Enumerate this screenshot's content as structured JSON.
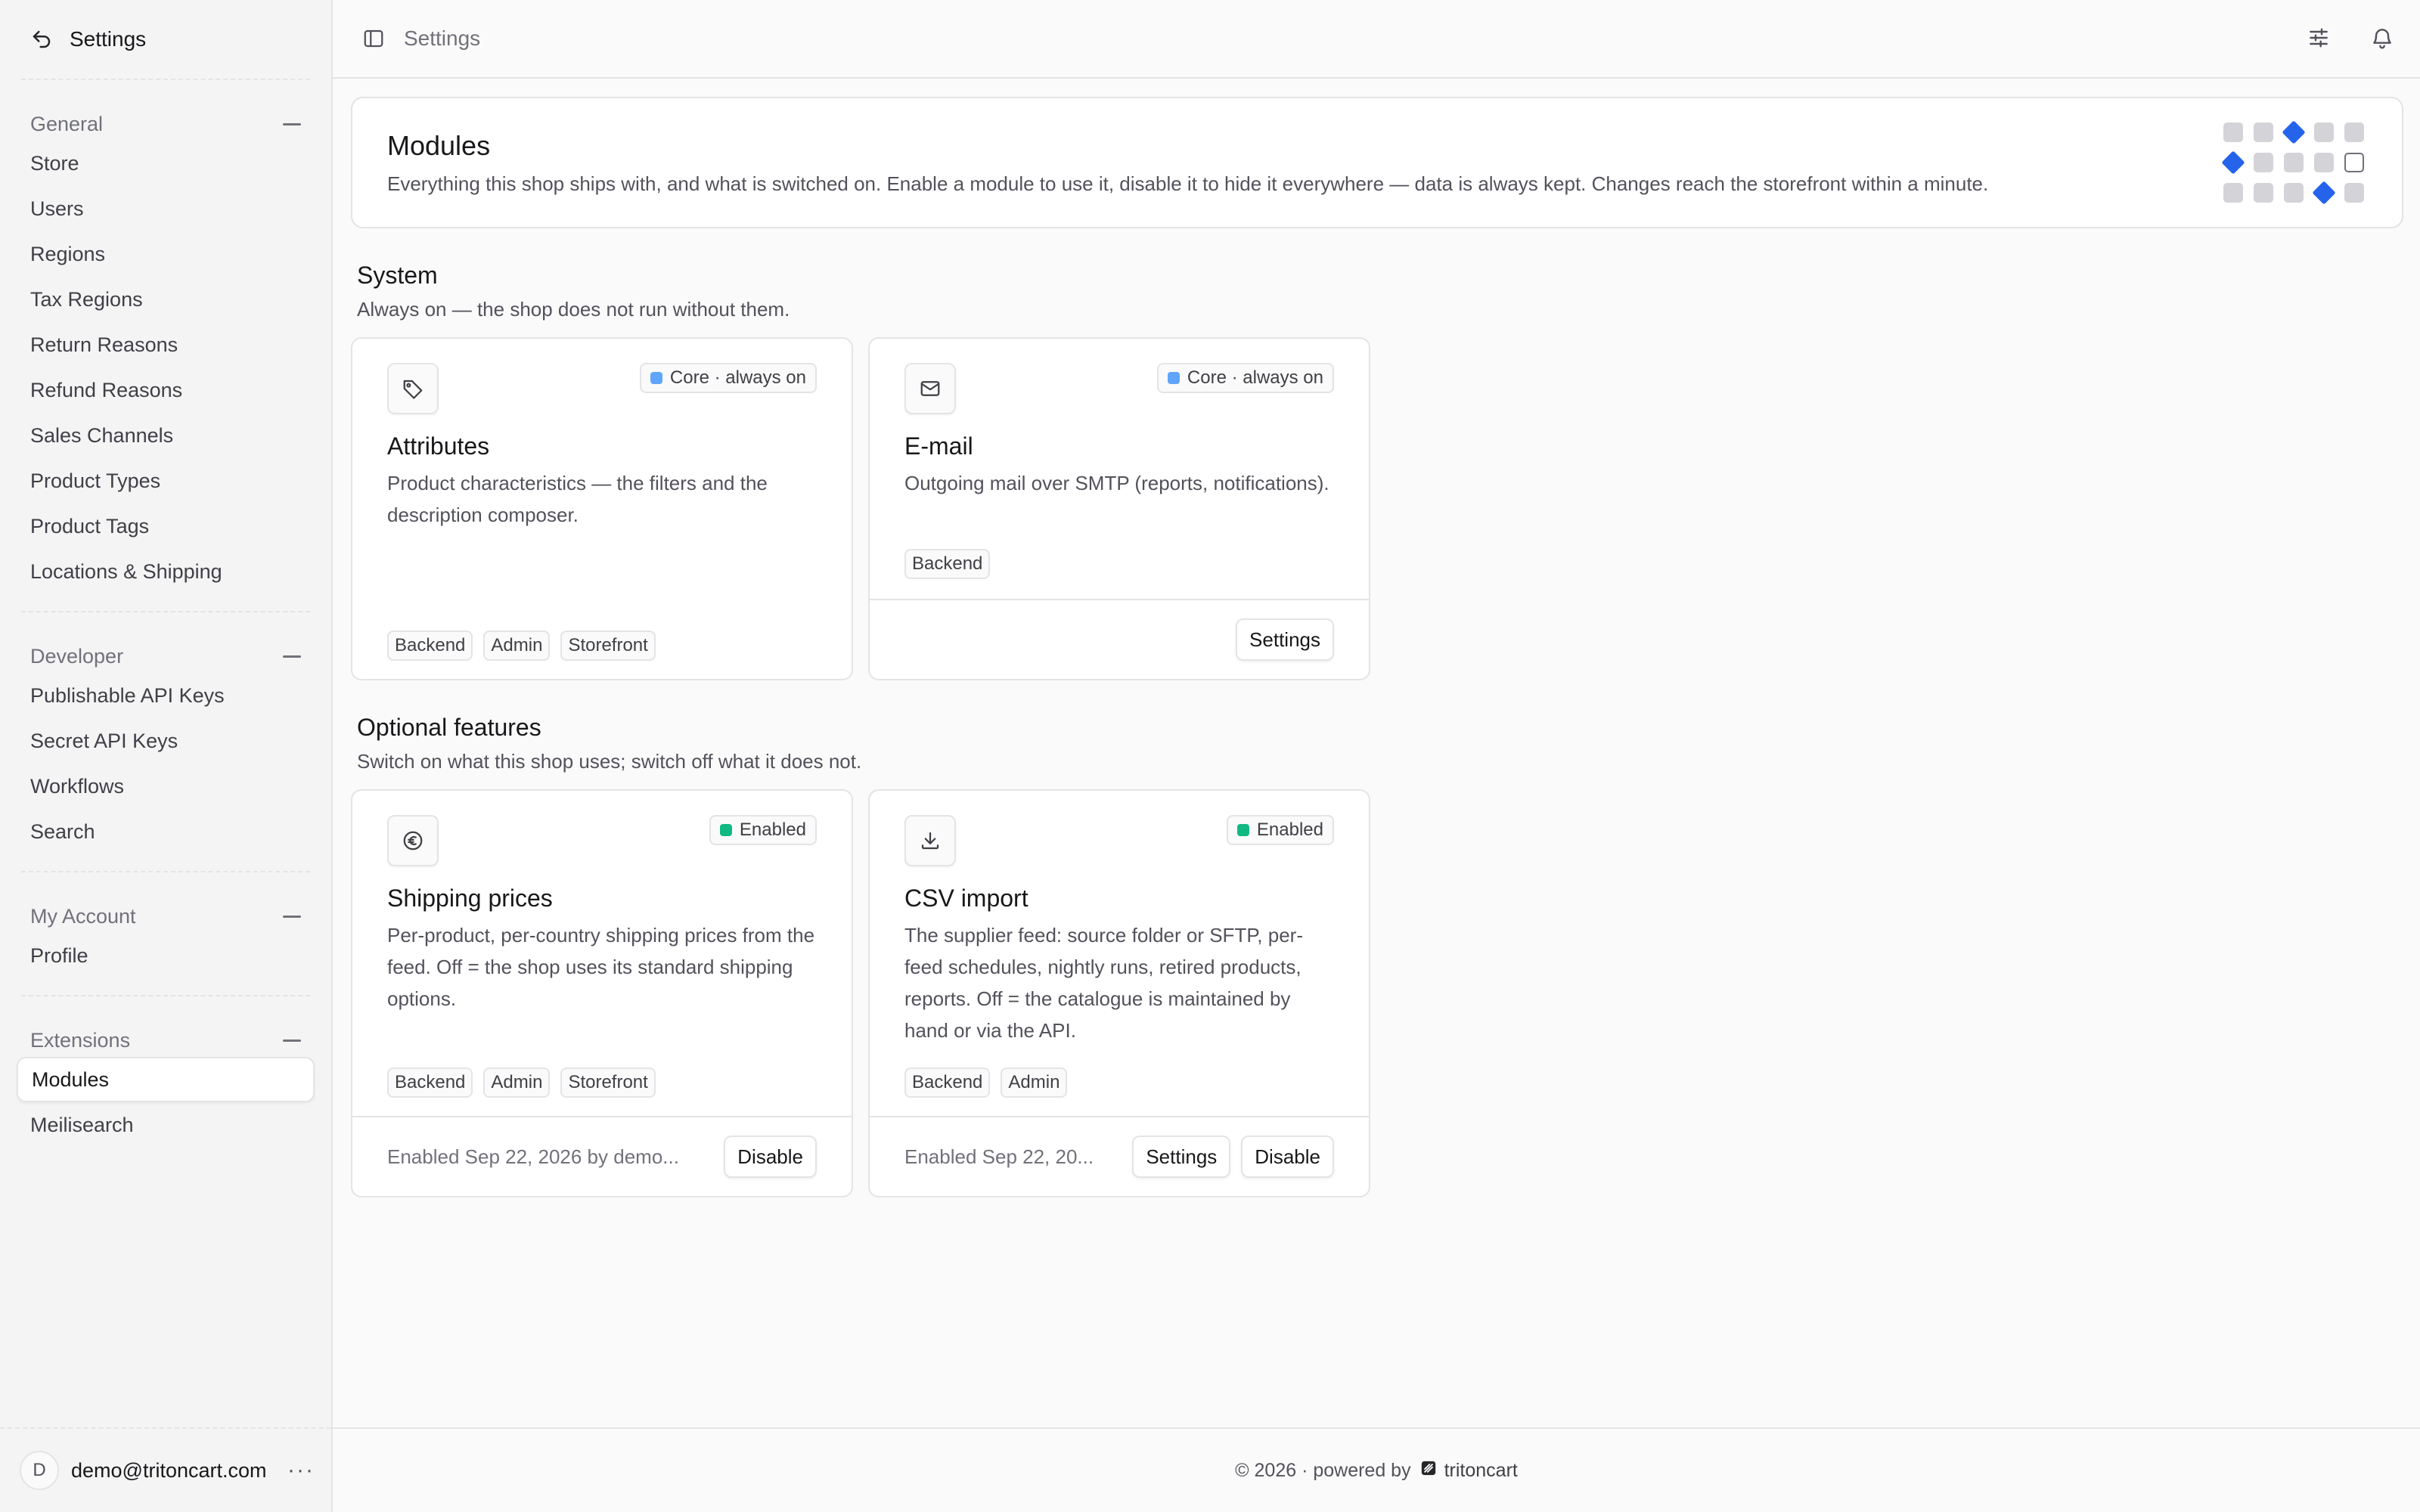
{
  "sidebar": {
    "title": "Settings",
    "groups": [
      {
        "label": "General",
        "items": [
          "Store",
          "Users",
          "Regions",
          "Tax Regions",
          "Return Reasons",
          "Refund Reasons",
          "Sales Channels",
          "Product Types",
          "Product Tags",
          "Locations & Shipping"
        ]
      },
      {
        "label": "Developer",
        "items": [
          "Publishable API Keys",
          "Secret API Keys",
          "Workflows",
          "Search"
        ]
      },
      {
        "label": "My Account",
        "items": [
          "Profile"
        ]
      },
      {
        "label": "Extensions",
        "items": [
          "Modules",
          "Meilisearch"
        ],
        "active": "Modules"
      }
    ],
    "user": {
      "initial": "D",
      "email": "demo@tritoncart.com",
      "menu": "···"
    }
  },
  "topbar": {
    "breadcrumb": "Settings"
  },
  "hero": {
    "title": "Modules",
    "description": "Everything this shop ships with, and what is switched on. Enable a module to use it, disable it to hide it everywhere — data is always kept. Changes reach the storefront within a minute."
  },
  "system": {
    "title": "System",
    "subtitle": "Always on — the shop does not run without them.",
    "cards": [
      {
        "icon": "tag-icon",
        "badge": "Core · always on",
        "title": "Attributes",
        "description": "Product characteristics — the filters and the description composer.",
        "tags": [
          "Backend",
          "Admin",
          "Storefront"
        ]
      },
      {
        "icon": "mail-icon",
        "badge": "Core · always on",
        "title": "E-mail",
        "description": "Outgoing mail over SMTP (reports, notifications).",
        "tags": [
          "Backend"
        ],
        "settings_label": "Settings"
      }
    ]
  },
  "optional": {
    "title": "Optional features",
    "subtitle": "Switch on what this shop uses; switch off what it does not.",
    "cards": [
      {
        "icon": "euro-icon",
        "badge": "Enabled",
        "title": "Shipping prices",
        "description": "Per-product, per-country shipping prices from the feed. Off = the shop uses its standard shipping options.",
        "tags": [
          "Backend",
          "Admin",
          "Storefront"
        ],
        "footer": "Enabled Sep 22, 2026 by demo...",
        "disable_label": "Disable"
      },
      {
        "icon": "download-icon",
        "badge": "Enabled",
        "title": "CSV import",
        "description": "The supplier feed: source folder or SFTP, per-feed schedules, nightly runs, retired products, reports. Off = the catalogue is maintained by hand or via the API.",
        "tags": [
          "Backend",
          "Admin"
        ],
        "footer": "Enabled Sep 22, 20...",
        "settings_label": "Settings",
        "disable_label": "Disable"
      }
    ]
  },
  "footer": {
    "text": "© 2026 · powered by",
    "brand": "tritoncart"
  },
  "colors": {
    "core": "#60a5fa",
    "enabled": "#10b981",
    "accent": "#2563eb"
  }
}
